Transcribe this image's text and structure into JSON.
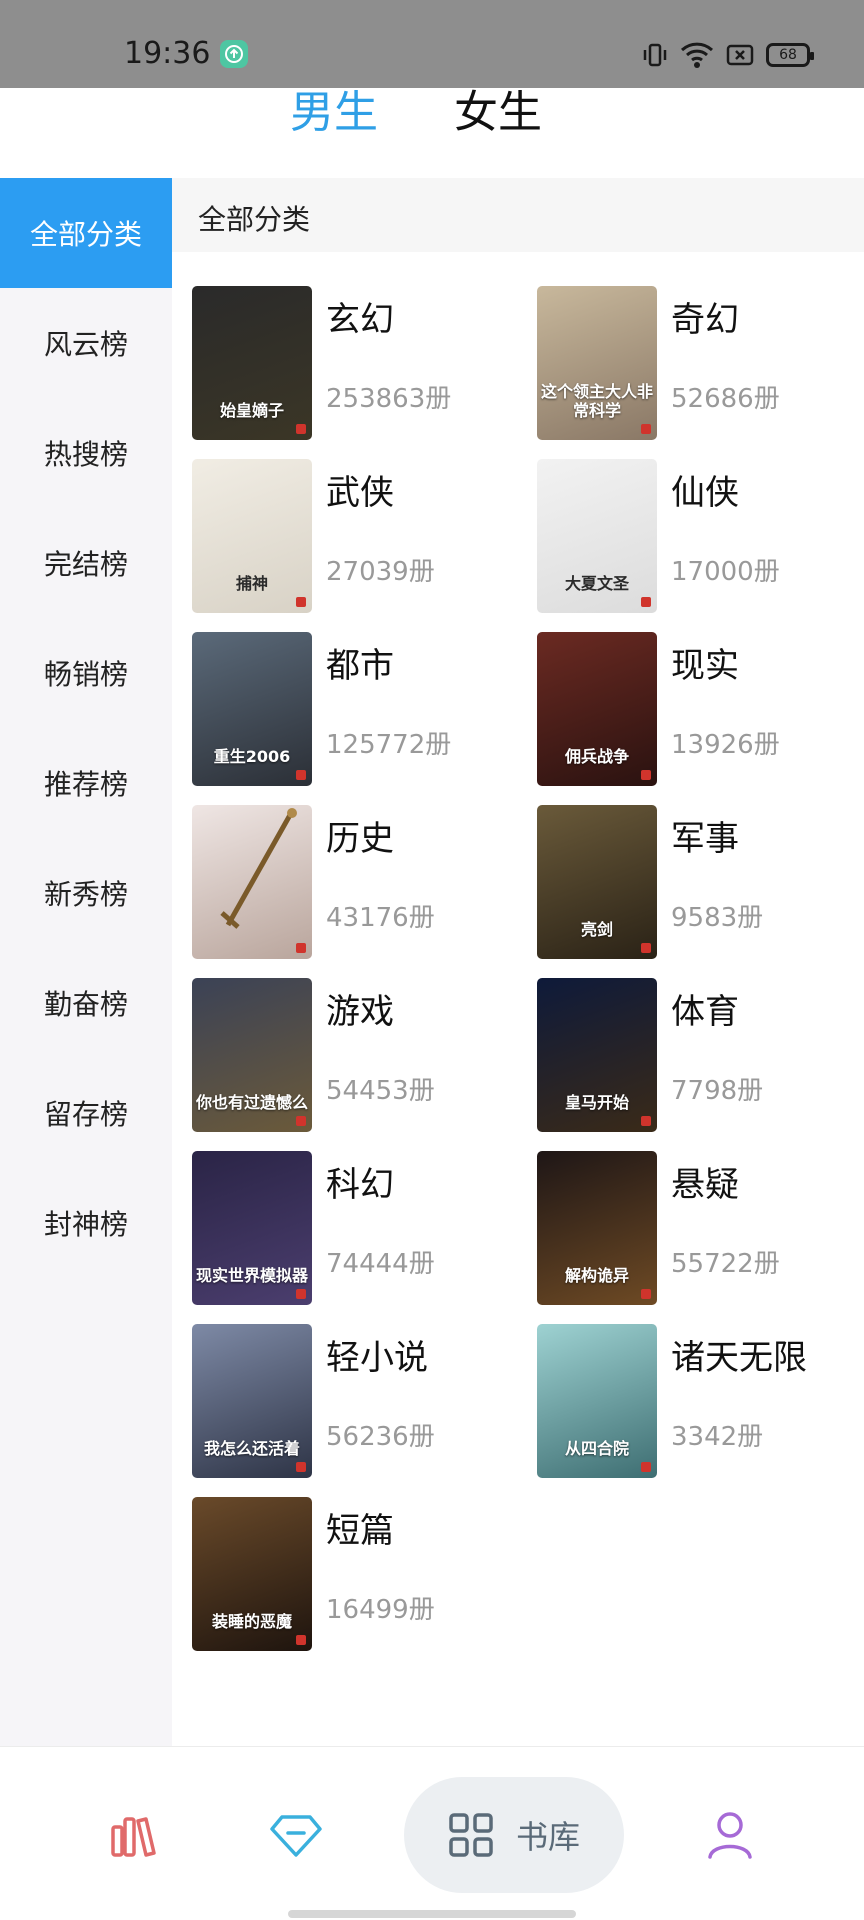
{
  "status_bar": {
    "time": "19:36",
    "battery": "68"
  },
  "gender_tabs": {
    "male": "男生",
    "female": "女生",
    "active": "male"
  },
  "sidebar": {
    "items": [
      {
        "label": "全部分类",
        "active": true
      },
      {
        "label": "风云榜"
      },
      {
        "label": "热搜榜"
      },
      {
        "label": "完结榜"
      },
      {
        "label": "畅销榜"
      },
      {
        "label": "推荐榜"
      },
      {
        "label": "新秀榜"
      },
      {
        "label": "勤奋榜"
      },
      {
        "label": "留存榜"
      },
      {
        "label": "封神榜"
      }
    ]
  },
  "main": {
    "header": "全部分类",
    "categories": [
      {
        "name": "玄幻",
        "count": "253863册",
        "cover_text": "始皇嫡子",
        "cover_colors": [
          "#2a2a2a",
          "#3b3626"
        ]
      },
      {
        "name": "奇幻",
        "count": "52686册",
        "cover_text": "这个领主大人非常科学",
        "cover_colors": [
          "#c8b89c",
          "#8a7866"
        ]
      },
      {
        "name": "武侠",
        "count": "27039册",
        "cover_text": "捕神",
        "cover_colors": [
          "#f1ede4",
          "#d8d2c6"
        ]
      },
      {
        "name": "仙侠",
        "count": "17000册",
        "cover_text": "大夏文圣",
        "cover_colors": [
          "#f2f2f2",
          "#dcdcdc"
        ]
      },
      {
        "name": "都市",
        "count": "125772册",
        "cover_text": "重生2006",
        "cover_colors": [
          "#5b6a7a",
          "#2b2f36"
        ]
      },
      {
        "name": "现实",
        "count": "13926册",
        "cover_text": "佣兵战争",
        "cover_colors": [
          "#6b2a22",
          "#2a1210"
        ]
      },
      {
        "name": "历史",
        "count": "43176册",
        "cover_text": "",
        "cover_colors": [
          "#efe6e4",
          "#b9a59c"
        ]
      },
      {
        "name": "军事",
        "count": "9583册",
        "cover_text": "亮剑",
        "cover_colors": [
          "#6a5a3a",
          "#2a2216"
        ]
      },
      {
        "name": "游戏",
        "count": "54453册",
        "cover_text": "你也有过遗憾么",
        "cover_colors": [
          "#3b4256",
          "#6b5a3a"
        ]
      },
      {
        "name": "体育",
        "count": "7798册",
        "cover_text": "皇马开始",
        "cover_colors": [
          "#0e1a3a",
          "#3a2a18"
        ]
      },
      {
        "name": "科幻",
        "count": "74444册",
        "cover_text": "现实世界模拟器",
        "cover_colors": [
          "#2a2446",
          "#4b3e6e"
        ]
      },
      {
        "name": "悬疑",
        "count": "55722册",
        "cover_text": "解构诡异",
        "cover_colors": [
          "#1e1616",
          "#6e4a24"
        ]
      },
      {
        "name": "轻小说",
        "count": "56236册",
        "cover_text": "我怎么还活着",
        "cover_colors": [
          "#7e8aa6",
          "#2e3446"
        ]
      },
      {
        "name": "诸天无限",
        "count": "3342册",
        "cover_text": "从四合院",
        "cover_colors": [
          "#9ed2d2",
          "#3e6e72"
        ]
      },
      {
        "name": "短篇",
        "count": "16499册",
        "cover_text": "装睡的恶魔",
        "cover_colors": [
          "#6a4a2a",
          "#1e140e"
        ]
      }
    ]
  },
  "bottom_nav": {
    "items": [
      {
        "icon": "bookshelf-icon",
        "color": "#e06a6a"
      },
      {
        "icon": "diamond-icon",
        "color": "#3ab0dd"
      },
      {
        "icon": "grid-icon",
        "label": "书库",
        "active": true,
        "color": "#5a6a78"
      },
      {
        "icon": "user-icon",
        "color": "#a66ad6"
      }
    ]
  }
}
